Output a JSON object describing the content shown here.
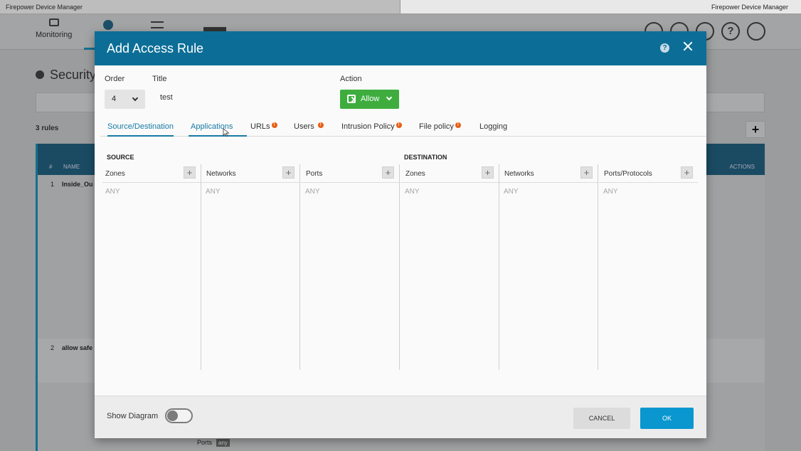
{
  "window": {
    "title_left": "Firepower Device Manager",
    "title_right": "Firepower Device Manager"
  },
  "background": {
    "nav_monitoring": "Monitoring",
    "page_title": "Security",
    "rules_count": "3 rules",
    "table_headers": [
      "#",
      "NAME",
      "ACTIONS"
    ],
    "rows": [
      {
        "num": "1",
        "name": "Inside_Ou"
      },
      {
        "num": "2",
        "name": "allow safe"
      }
    ],
    "bottom_label": "Ports",
    "bottom_tag": "any"
  },
  "modal": {
    "title": "Add Access Rule",
    "order_label": "Order",
    "order_value": "4",
    "title_label": "Title",
    "title_value": "test",
    "action_label": "Action",
    "action_value": "Allow",
    "tabs": [
      {
        "label": "Source/Destination",
        "state": "active",
        "warning": false
      },
      {
        "label": "Applications",
        "state": "hover",
        "warning": false
      },
      {
        "label": "URLs",
        "state": "normal",
        "warning": true
      },
      {
        "label": "Users",
        "state": "normal",
        "warning": true
      },
      {
        "label": "Intrusion Policy",
        "state": "normal",
        "warning": true
      },
      {
        "label": "File policy",
        "state": "normal",
        "warning": true
      },
      {
        "label": "Logging",
        "state": "normal",
        "warning": false
      }
    ],
    "source": {
      "heading": "SOURCE",
      "columns": [
        {
          "label": "Zones",
          "value": "ANY"
        },
        {
          "label": "Networks",
          "value": "ANY"
        },
        {
          "label": "Ports",
          "value": "ANY"
        }
      ]
    },
    "destination": {
      "heading": "DESTINATION",
      "columns": [
        {
          "label": "Zones",
          "value": "ANY"
        },
        {
          "label": "Networks",
          "value": "ANY"
        },
        {
          "label": "Ports/Protocols",
          "value": "ANY"
        }
      ]
    },
    "footer": {
      "show_diagram_label": "Show Diagram",
      "show_diagram_on": false,
      "cancel_label": "CANCEL",
      "ok_label": "OK"
    }
  },
  "colors": {
    "header_blue": "#0c6e97",
    "allow_green": "#3ead3e",
    "ok_blue": "#0a97cf",
    "warning_orange": "#e85e14",
    "tab_active": "#177aa4"
  },
  "icons": {
    "warning": "warning-dot-icon",
    "help": "help-icon",
    "close": "close-icon",
    "add": "plus-icon"
  }
}
